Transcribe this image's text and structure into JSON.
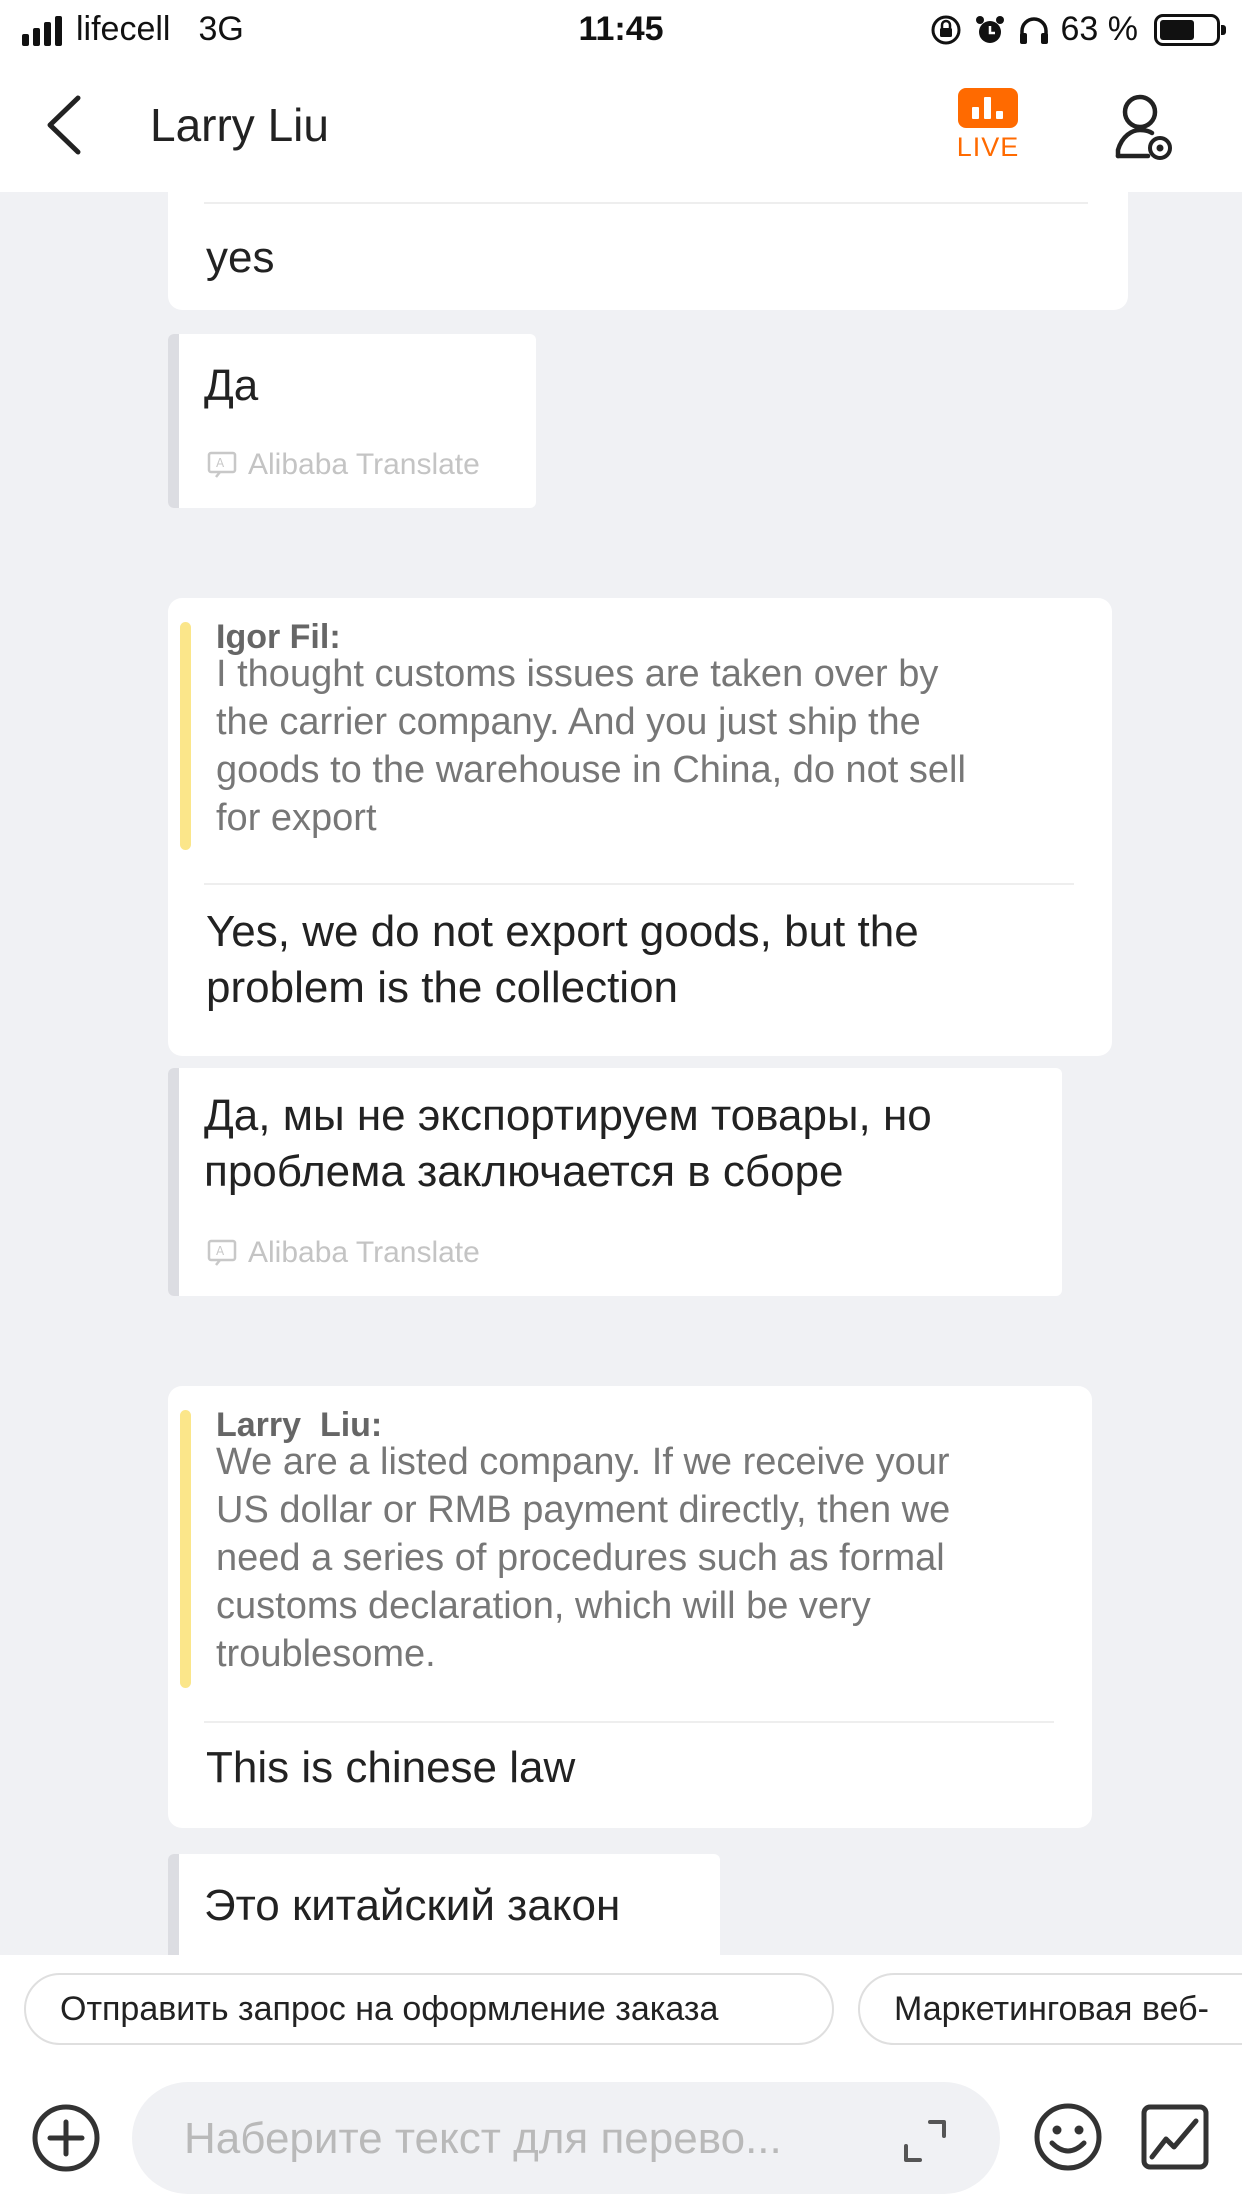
{
  "status_bar": {
    "carrier": "lifecell",
    "network": "3G",
    "time": "11:45",
    "battery_text": "63 %",
    "battery_level": 0.63,
    "icons": [
      "signal-icon",
      "orientation-lock-icon",
      "alarm-icon",
      "headphones-icon",
      "battery-icon"
    ]
  },
  "header": {
    "back_icon": "chevron-left-icon",
    "contact_name": "Larry Liu",
    "live_label": "LIVE",
    "live_color": "#ff6a00",
    "profile_icon": "contact-settings-icon"
  },
  "messages": [
    {
      "text": "yes",
      "translation": "Да",
      "translation_source": "Alibaba Translate"
    },
    {
      "quote_author": "Igor Fil:",
      "quote_lines": [
        "I thought customs issues are taken over by",
        "the carrier company. And you just ship the",
        "goods to the warehouse in China, do not sell",
        "for export"
      ],
      "text_lines": [
        "Yes, we do not export goods, but the",
        "problem is the collection"
      ],
      "translation_lines": [
        "Да, мы не экспортируем товары, но",
        "проблема заключается в сборе"
      ],
      "translation_source": "Alibaba Translate"
    },
    {
      "quote_author": "Larry  Liu:",
      "quote_lines": [
        "We are a listed company. If we receive your",
        "US dollar or RMB payment directly, then we",
        "need a series of procedures such as formal",
        "customs declaration, which will be very",
        "troublesome."
      ],
      "text": "This is chinese law",
      "translation": "Это китайский закон"
    }
  ],
  "quick_replies": [
    "Отправить запрос на оформление заказа",
    "Маркетинговая веб-"
  ],
  "composer": {
    "plus_icon": "plus-circle-icon",
    "placeholder": "Наберите текст для перево...",
    "expand_icon": "expand-icon",
    "emoji_icon": "emoji-icon",
    "image_icon": "image-icon"
  },
  "colors": {
    "accent": "#ff6a00",
    "quote_bar": "#fbe68a",
    "chat_background": "#f0f1f4",
    "translation_edge": "#dcdde2"
  }
}
